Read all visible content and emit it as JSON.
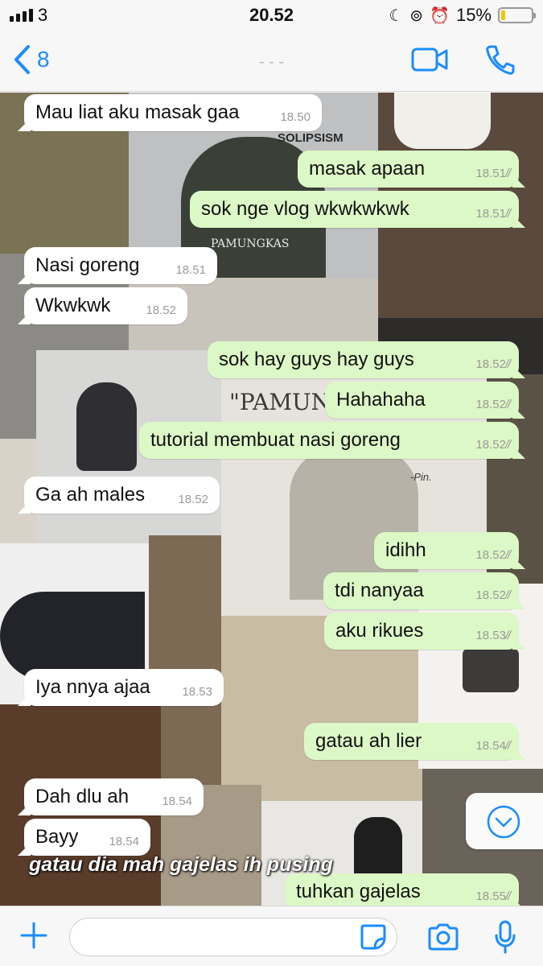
{
  "status": {
    "carrier": "3",
    "time": "20.52",
    "battery_pct": "15%",
    "battery_level": 0.15
  },
  "nav": {
    "back_count": "8",
    "title": "- - -"
  },
  "messages": [
    {
      "dir": "in",
      "text": "Mau liat aku masak gaa",
      "time": "18.50"
    },
    {
      "dir": "out",
      "text": "masak apaan",
      "time": "18.51"
    },
    {
      "dir": "out",
      "text": "sok nge vlog wkwkwkwk",
      "time": "18.51"
    },
    {
      "dir": "in",
      "text": "Nasi goreng",
      "time": "18.51"
    },
    {
      "dir": "in",
      "text": "Wkwkwk",
      "time": "18.52"
    },
    {
      "dir": "out",
      "text": "sok hay guys hay guys",
      "time": "18.52"
    },
    {
      "dir": "out",
      "text": "Hahahaha",
      "time": "18.52"
    },
    {
      "dir": "out",
      "text": "tutorial membuat nasi goreng",
      "time": "18.52"
    },
    {
      "dir": "in",
      "text": "Ga ah males",
      "time": "18.52"
    },
    {
      "dir": "out",
      "text": "idihh",
      "time": "18.52"
    },
    {
      "dir": "out",
      "text": "tdi nanyaa",
      "time": "18.52"
    },
    {
      "dir": "out",
      "text": "aku rikues",
      "time": "18.53"
    },
    {
      "dir": "in",
      "text": "Iya nnya ajaa",
      "time": "18.53"
    },
    {
      "dir": "out",
      "text": "gatau ah lier",
      "time": "18.54"
    },
    {
      "dir": "in",
      "text": "Dah dlu ah",
      "time": "18.54"
    },
    {
      "dir": "in",
      "text": "Bayy",
      "time": "18.54"
    },
    {
      "dir": "out",
      "text": "tuhkan gajelas",
      "time": "18.55"
    }
  ],
  "overlay_caption": "gatau dia mah gajelas ih pusing",
  "background_texts": {
    "newspaper": "SOLIPSISM",
    "shirt": "PAMUNGKAS",
    "sketch": "\"PAMUN",
    "sketch_sig": "-Pin."
  },
  "colors": {
    "accent": "#1a8cff",
    "outgoing_bubble": "#dcf8c6",
    "incoming_bubble": "#ffffff"
  }
}
